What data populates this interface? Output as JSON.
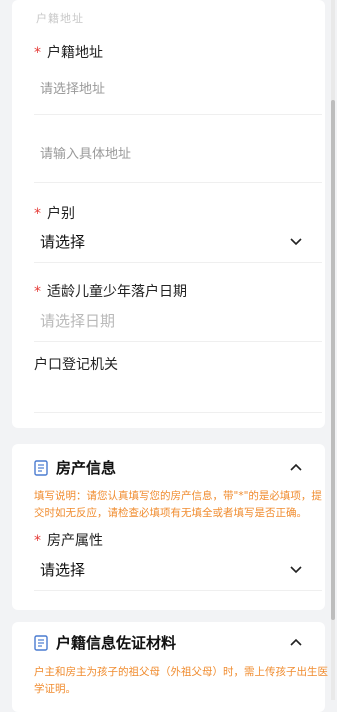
{
  "top_cut_label": "户籍地址",
  "household_form": {
    "address_label": "户籍地址",
    "address_select_placeholder": "请选择地址",
    "address_detail_placeholder": "请输入具体地址",
    "category_label": "户别",
    "category_value": "请选择",
    "settle_date_label": "适龄儿童少年落户日期",
    "settle_date_placeholder": "请选择日期",
    "registry_office_label": "户口登记机关"
  },
  "property_section": {
    "title": "房产信息",
    "note": "填写说明：请您认真填写您的房产信息，带\"*\"的是必填项，提交时如无反应，请检查必填项有无填全或者填写是否正确。",
    "attribute_label": "房产属性",
    "attribute_value": "请选择"
  },
  "materials_section": {
    "title": "户籍信息佐证材料",
    "note": "户主和房主为孩子的祖父母（外祖父母）时，需上传孩子出生医学证明。"
  },
  "colors": {
    "required": "#e53935",
    "note": "#f08c2f",
    "background": "#f2f3f5"
  }
}
